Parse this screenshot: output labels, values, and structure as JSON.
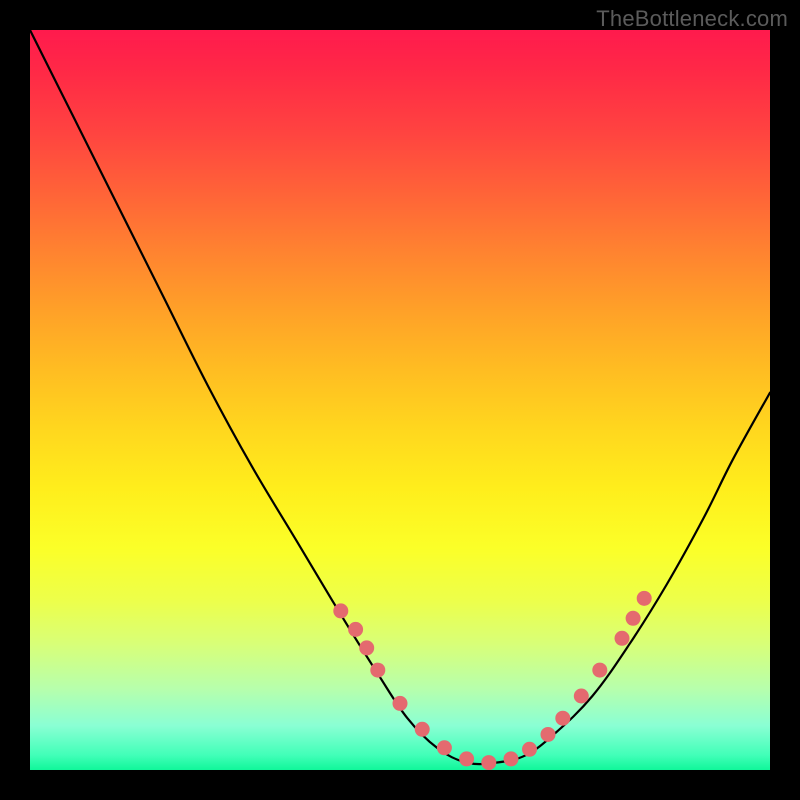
{
  "watermark": "TheBottleneck.com",
  "chart_data": {
    "type": "line",
    "title": "",
    "xlabel": "",
    "ylabel": "",
    "xlim": [
      0,
      1
    ],
    "ylim": [
      0,
      1
    ],
    "series": [
      {
        "name": "bottleneck-curve",
        "x": [
          0.0,
          0.06,
          0.12,
          0.18,
          0.24,
          0.3,
          0.36,
          0.42,
          0.47,
          0.51,
          0.55,
          0.59,
          0.63,
          0.67,
          0.71,
          0.76,
          0.81,
          0.86,
          0.91,
          0.95,
          1.0
        ],
        "y": [
          1.0,
          0.88,
          0.76,
          0.64,
          0.52,
          0.41,
          0.31,
          0.21,
          0.13,
          0.07,
          0.03,
          0.01,
          0.01,
          0.02,
          0.05,
          0.1,
          0.17,
          0.25,
          0.34,
          0.42,
          0.51
        ]
      }
    ],
    "markers": {
      "name": "highlight-dots",
      "x": [
        0.42,
        0.44,
        0.455,
        0.47,
        0.5,
        0.53,
        0.56,
        0.59,
        0.62,
        0.65,
        0.675,
        0.7,
        0.72,
        0.745,
        0.77,
        0.8,
        0.815,
        0.83
      ],
      "y": [
        0.215,
        0.19,
        0.165,
        0.135,
        0.09,
        0.055,
        0.03,
        0.015,
        0.01,
        0.015,
        0.028,
        0.048,
        0.07,
        0.1,
        0.135,
        0.178,
        0.205,
        0.232
      ]
    },
    "background": "vertical-gradient red→yellow→green",
    "grid": false,
    "legend": false
  }
}
